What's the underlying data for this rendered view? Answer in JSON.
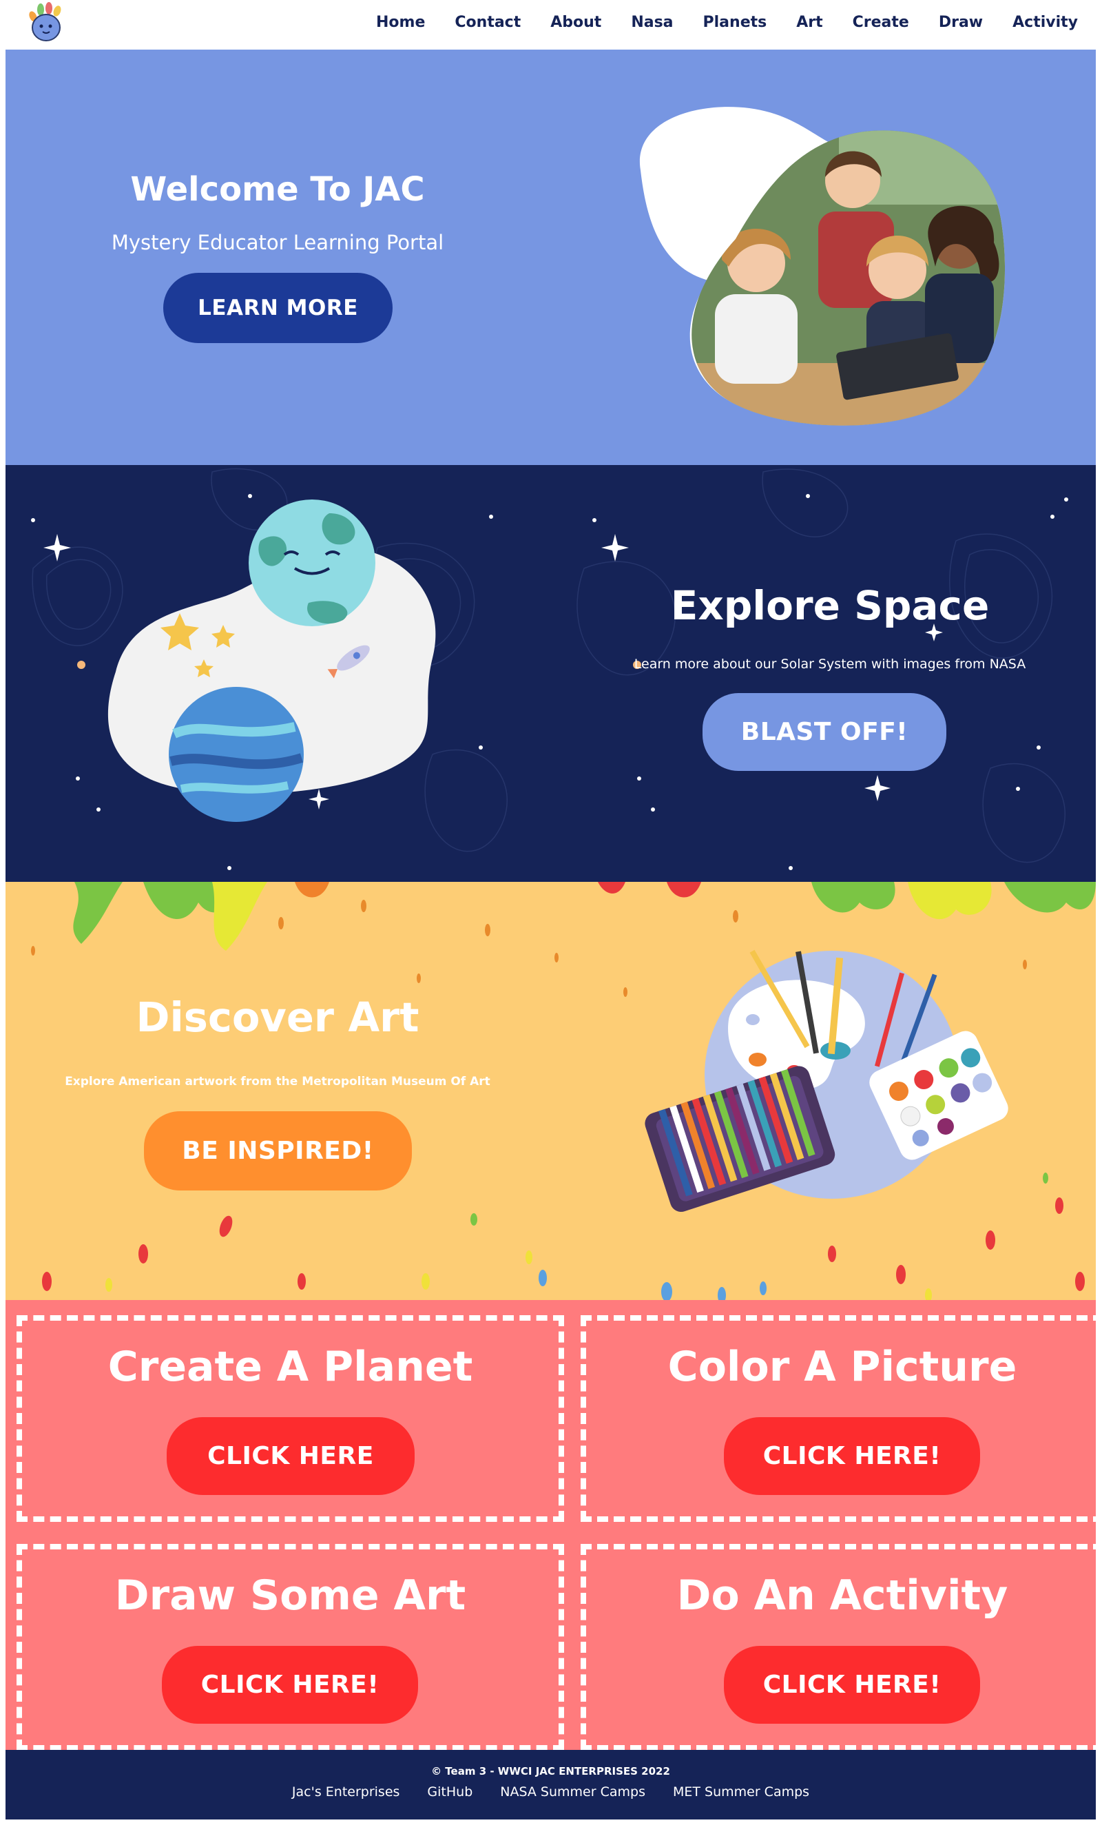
{
  "nav": {
    "items": [
      "Home",
      "Contact",
      "About",
      "Nasa",
      "Planets",
      "Art",
      "Create",
      "Draw",
      "Activity"
    ]
  },
  "hero": {
    "title": "Welcome To JAC",
    "subtitle": "Mystery Educator Learning Portal",
    "button": "LEARN MORE"
  },
  "space": {
    "title": "Explore Space",
    "subtitle": "Learn more about our Solar System with images from NASA",
    "button": "BLAST OFF!"
  },
  "art": {
    "title": "Discover Art",
    "subtitle": "Explore American artwork from the Metropolitan Museum Of Art",
    "button": "BE INSPIRED!"
  },
  "cards": [
    {
      "title": "Create A Planet",
      "button": "CLICK HERE"
    },
    {
      "title": "Color A Picture",
      "button": "CLICK HERE!"
    },
    {
      "title": "Draw Some Art",
      "button": "CLICK HERE!"
    },
    {
      "title": "Do An Activity",
      "button": "CLICK HERE!"
    }
  ],
  "footer": {
    "copyright": "© Team 3 - WWCI JAC ENTERPRISES 2022",
    "links": [
      "Jac's Enterprises",
      "GitHub",
      "NASA Summer Camps",
      "MET Summer Camps"
    ]
  },
  "colors": {
    "navy": "#152357",
    "hero_blue": "#7796e2",
    "hero_button": "#1c3a97",
    "art_yellow": "#fdcd75",
    "art_button": "#ff8f2e",
    "card_pink": "#ff7b7d",
    "card_button": "#fd2c2e"
  }
}
